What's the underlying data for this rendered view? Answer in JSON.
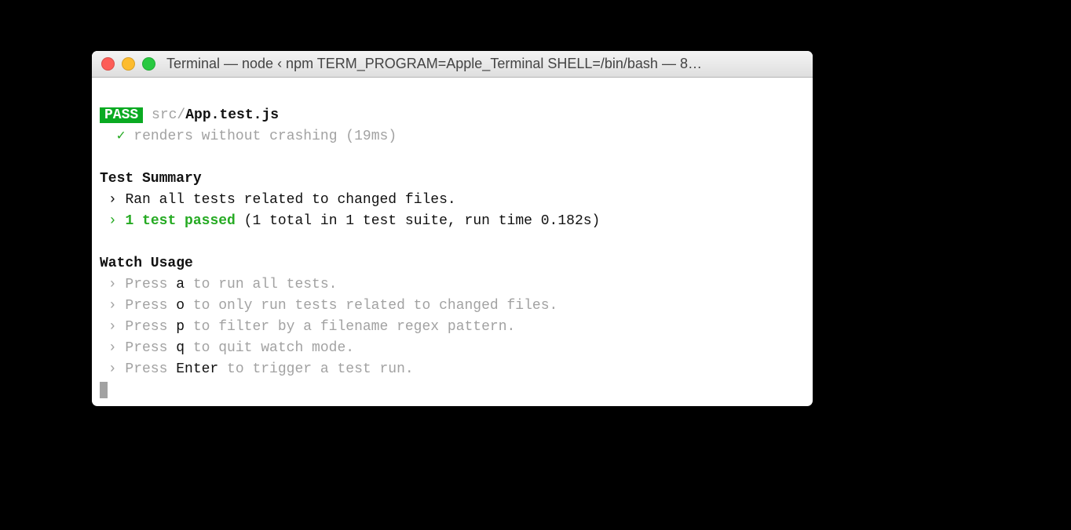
{
  "window": {
    "title": "Terminal — node ‹ npm TERM_PROGRAM=Apple_Terminal SHELL=/bin/bash — 8…"
  },
  "test_run": {
    "badge": "PASS",
    "file_dir": "src/",
    "file_name": "App.test.js",
    "check_mark": "✓",
    "test_desc": "renders without crashing (19ms)"
  },
  "summary": {
    "heading": "Test Summary",
    "arrow1": "›",
    "line1": "Ran all tests related to changed files.",
    "arrow2": "›",
    "passed_strong": "1 test passed",
    "passed_rest": " (1 total in 1 test suite, run time 0.182s)"
  },
  "watch": {
    "heading": "Watch Usage",
    "items": [
      {
        "prefix": " › Press ",
        "key": "a",
        "suffix": " to run all tests."
      },
      {
        "prefix": " › Press ",
        "key": "o",
        "suffix": " to only run tests related to changed files."
      },
      {
        "prefix": " › Press ",
        "key": "p",
        "suffix": " to filter by a filename regex pattern."
      },
      {
        "prefix": " › Press ",
        "key": "q",
        "suffix": " to quit watch mode."
      },
      {
        "prefix": " › Press ",
        "key": "Enter",
        "suffix": " to trigger a test run."
      }
    ]
  }
}
